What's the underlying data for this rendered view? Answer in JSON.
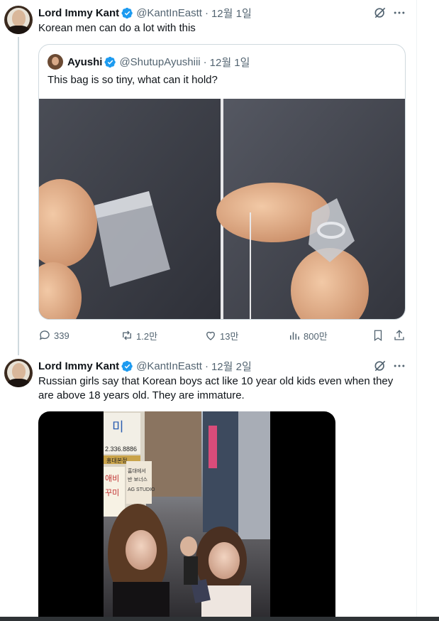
{
  "tweet1": {
    "author_name": "Lord Immy Kant",
    "handle": "@KantInEastt",
    "separator": "·",
    "time": "12월 1일",
    "text": "Korean men can do a lot with this",
    "quoted": {
      "author_name": "Ayushi",
      "handle": "@ShutupAyushiii",
      "separator": "·",
      "time": "12월 1일",
      "text": "This bag is so tiny, what can it hold?",
      "media_icon": "photo-two-panels"
    },
    "actions": {
      "replies": "339",
      "reposts": "1.2만",
      "likes": "13만",
      "views": "800만"
    }
  },
  "tweet2": {
    "author_name": "Lord Immy Kant",
    "handle": "@KantInEastt",
    "separator": "·",
    "time": "12월 2일",
    "text_line1": "Russian girls say that Korean boys act like 10 year old kids even when they",
    "text_line2": "are above 18 years old. They are immature.",
    "media": {
      "signs": [
        "미",
        "2.336.8886",
        "홍대본점",
        "애비",
        "꾸미",
        "홈대에서",
        "반 보너스",
        "AG STUDIO"
      ]
    }
  },
  "colors": {
    "verified": "#1d9bf0",
    "secondary_text": "#536471",
    "border": "#cfd9de"
  },
  "icons": [
    "grok-icon",
    "more-icon",
    "reply-icon",
    "repost-icon",
    "like-icon",
    "views-icon",
    "bookmark-icon",
    "share-icon",
    "verified-badge-icon"
  ]
}
